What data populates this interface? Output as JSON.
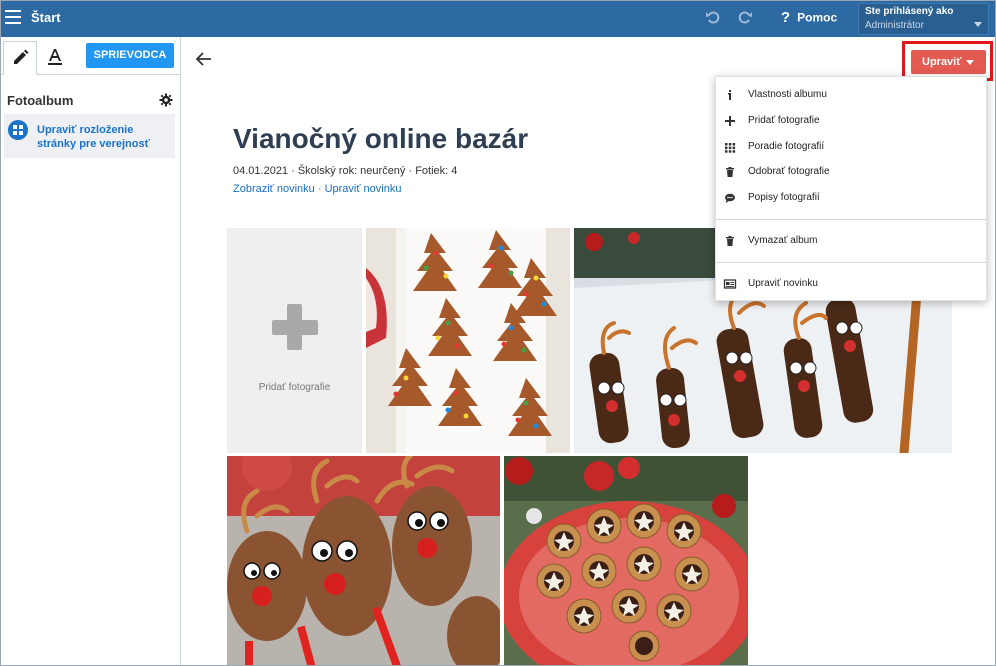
{
  "topbar": {
    "title": "Štart",
    "help_label": "Pomoc",
    "user_line1": "Ste prihlásený ako",
    "user_line2": "Administrátor",
    "bg_color": "#2d6aa3"
  },
  "left_panel": {
    "tabs": [
      {
        "name": "edit",
        "icon": "pencil-icon"
      },
      {
        "name": "text",
        "icon": "text-format-icon"
      }
    ],
    "guide_button": "SPRIEVODCA",
    "section_title": "Fotoalbum",
    "layout_item": "Upraviť rozloženie stránky pre verejnosť"
  },
  "album": {
    "title": "Vianočný online bazár",
    "meta": "04.01.2021 · Školský rok: neurčený · Fotiek: 4",
    "link_show": "Zobraziť novinku",
    "link_sep": "·",
    "link_edit": "Upraviť novinku",
    "add_photo_label": "Pridať fotografie",
    "photos": [
      {
        "subject": "gingerbread tree cookies"
      },
      {
        "subject": "chocolate pretzel reindeer"
      },
      {
        "subject": "reindeer cookies"
      },
      {
        "subject": "mince pies on red plate"
      }
    ]
  },
  "edit_button": {
    "label": "Upraviť",
    "color": "#e25a52",
    "highlight_color": "#e0161b"
  },
  "dropdown": {
    "items": [
      {
        "label": "Vlastnosti albumu",
        "icon": "info-icon"
      },
      {
        "label": "Pridať fotografie",
        "icon": "plus-icon"
      },
      {
        "label": "Poradie fotografií",
        "icon": "grid-icon"
      },
      {
        "label": "Odobrať fotografie",
        "icon": "trash-icon"
      },
      {
        "label": "Popisy fotografií",
        "icon": "comment-icon"
      },
      {
        "label": "Vymazať album",
        "icon": "trash-icon"
      },
      {
        "label": "Upraviť novinku",
        "icon": "news-icon"
      }
    ]
  }
}
